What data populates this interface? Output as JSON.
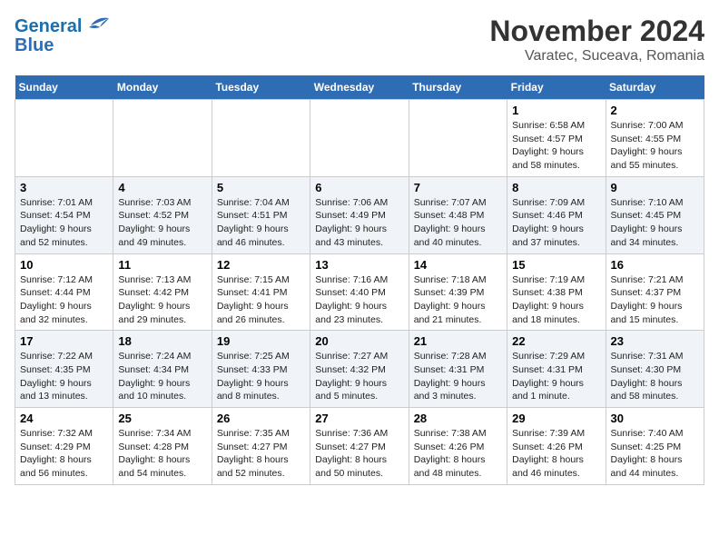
{
  "header": {
    "logo_line1": "General",
    "logo_line2": "Blue",
    "title": "November 2024",
    "subtitle": "Varatec, Suceava, Romania"
  },
  "weekdays": [
    "Sunday",
    "Monday",
    "Tuesday",
    "Wednesday",
    "Thursday",
    "Friday",
    "Saturday"
  ],
  "weeks": [
    [
      {
        "day": "",
        "sunrise": "",
        "sunset": "",
        "daylight": ""
      },
      {
        "day": "",
        "sunrise": "",
        "sunset": "",
        "daylight": ""
      },
      {
        "day": "",
        "sunrise": "",
        "sunset": "",
        "daylight": ""
      },
      {
        "day": "",
        "sunrise": "",
        "sunset": "",
        "daylight": ""
      },
      {
        "day": "",
        "sunrise": "",
        "sunset": "",
        "daylight": ""
      },
      {
        "day": "1",
        "sunrise": "Sunrise: 6:58 AM",
        "sunset": "Sunset: 4:57 PM",
        "daylight": "Daylight: 9 hours and 58 minutes."
      },
      {
        "day": "2",
        "sunrise": "Sunrise: 7:00 AM",
        "sunset": "Sunset: 4:55 PM",
        "daylight": "Daylight: 9 hours and 55 minutes."
      }
    ],
    [
      {
        "day": "3",
        "sunrise": "Sunrise: 7:01 AM",
        "sunset": "Sunset: 4:54 PM",
        "daylight": "Daylight: 9 hours and 52 minutes."
      },
      {
        "day": "4",
        "sunrise": "Sunrise: 7:03 AM",
        "sunset": "Sunset: 4:52 PM",
        "daylight": "Daylight: 9 hours and 49 minutes."
      },
      {
        "day": "5",
        "sunrise": "Sunrise: 7:04 AM",
        "sunset": "Sunset: 4:51 PM",
        "daylight": "Daylight: 9 hours and 46 minutes."
      },
      {
        "day": "6",
        "sunrise": "Sunrise: 7:06 AM",
        "sunset": "Sunset: 4:49 PM",
        "daylight": "Daylight: 9 hours and 43 minutes."
      },
      {
        "day": "7",
        "sunrise": "Sunrise: 7:07 AM",
        "sunset": "Sunset: 4:48 PM",
        "daylight": "Daylight: 9 hours and 40 minutes."
      },
      {
        "day": "8",
        "sunrise": "Sunrise: 7:09 AM",
        "sunset": "Sunset: 4:46 PM",
        "daylight": "Daylight: 9 hours and 37 minutes."
      },
      {
        "day": "9",
        "sunrise": "Sunrise: 7:10 AM",
        "sunset": "Sunset: 4:45 PM",
        "daylight": "Daylight: 9 hours and 34 minutes."
      }
    ],
    [
      {
        "day": "10",
        "sunrise": "Sunrise: 7:12 AM",
        "sunset": "Sunset: 4:44 PM",
        "daylight": "Daylight: 9 hours and 32 minutes."
      },
      {
        "day": "11",
        "sunrise": "Sunrise: 7:13 AM",
        "sunset": "Sunset: 4:42 PM",
        "daylight": "Daylight: 9 hours and 29 minutes."
      },
      {
        "day": "12",
        "sunrise": "Sunrise: 7:15 AM",
        "sunset": "Sunset: 4:41 PM",
        "daylight": "Daylight: 9 hours and 26 minutes."
      },
      {
        "day": "13",
        "sunrise": "Sunrise: 7:16 AM",
        "sunset": "Sunset: 4:40 PM",
        "daylight": "Daylight: 9 hours and 23 minutes."
      },
      {
        "day": "14",
        "sunrise": "Sunrise: 7:18 AM",
        "sunset": "Sunset: 4:39 PM",
        "daylight": "Daylight: 9 hours and 21 minutes."
      },
      {
        "day": "15",
        "sunrise": "Sunrise: 7:19 AM",
        "sunset": "Sunset: 4:38 PM",
        "daylight": "Daylight: 9 hours and 18 minutes."
      },
      {
        "day": "16",
        "sunrise": "Sunrise: 7:21 AM",
        "sunset": "Sunset: 4:37 PM",
        "daylight": "Daylight: 9 hours and 15 minutes."
      }
    ],
    [
      {
        "day": "17",
        "sunrise": "Sunrise: 7:22 AM",
        "sunset": "Sunset: 4:35 PM",
        "daylight": "Daylight: 9 hours and 13 minutes."
      },
      {
        "day": "18",
        "sunrise": "Sunrise: 7:24 AM",
        "sunset": "Sunset: 4:34 PM",
        "daylight": "Daylight: 9 hours and 10 minutes."
      },
      {
        "day": "19",
        "sunrise": "Sunrise: 7:25 AM",
        "sunset": "Sunset: 4:33 PM",
        "daylight": "Daylight: 9 hours and 8 minutes."
      },
      {
        "day": "20",
        "sunrise": "Sunrise: 7:27 AM",
        "sunset": "Sunset: 4:32 PM",
        "daylight": "Daylight: 9 hours and 5 minutes."
      },
      {
        "day": "21",
        "sunrise": "Sunrise: 7:28 AM",
        "sunset": "Sunset: 4:31 PM",
        "daylight": "Daylight: 9 hours and 3 minutes."
      },
      {
        "day": "22",
        "sunrise": "Sunrise: 7:29 AM",
        "sunset": "Sunset: 4:31 PM",
        "daylight": "Daylight: 9 hours and 1 minute."
      },
      {
        "day": "23",
        "sunrise": "Sunrise: 7:31 AM",
        "sunset": "Sunset: 4:30 PM",
        "daylight": "Daylight: 8 hours and 58 minutes."
      }
    ],
    [
      {
        "day": "24",
        "sunrise": "Sunrise: 7:32 AM",
        "sunset": "Sunset: 4:29 PM",
        "daylight": "Daylight: 8 hours and 56 minutes."
      },
      {
        "day": "25",
        "sunrise": "Sunrise: 7:34 AM",
        "sunset": "Sunset: 4:28 PM",
        "daylight": "Daylight: 8 hours and 54 minutes."
      },
      {
        "day": "26",
        "sunrise": "Sunrise: 7:35 AM",
        "sunset": "Sunset: 4:27 PM",
        "daylight": "Daylight: 8 hours and 52 minutes."
      },
      {
        "day": "27",
        "sunrise": "Sunrise: 7:36 AM",
        "sunset": "Sunset: 4:27 PM",
        "daylight": "Daylight: 8 hours and 50 minutes."
      },
      {
        "day": "28",
        "sunrise": "Sunrise: 7:38 AM",
        "sunset": "Sunset: 4:26 PM",
        "daylight": "Daylight: 8 hours and 48 minutes."
      },
      {
        "day": "29",
        "sunrise": "Sunrise: 7:39 AM",
        "sunset": "Sunset: 4:26 PM",
        "daylight": "Daylight: 8 hours and 46 minutes."
      },
      {
        "day": "30",
        "sunrise": "Sunrise: 7:40 AM",
        "sunset": "Sunset: 4:25 PM",
        "daylight": "Daylight: 8 hours and 44 minutes."
      }
    ]
  ]
}
